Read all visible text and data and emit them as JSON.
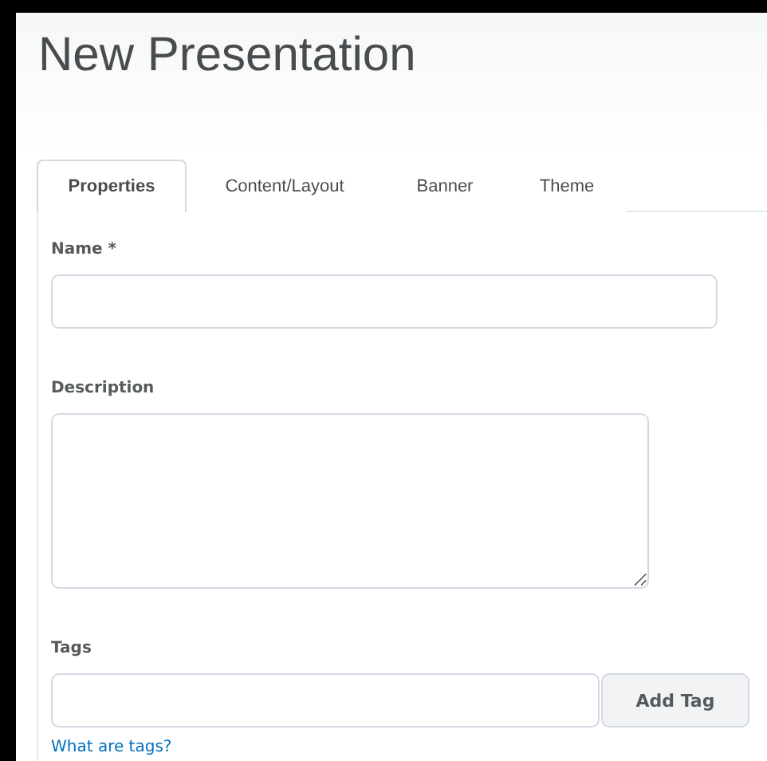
{
  "title": "New Presentation",
  "tabs": [
    {
      "label": "Properties",
      "selected": true
    },
    {
      "label": "Content/Layout",
      "selected": false
    },
    {
      "label": "Banner",
      "selected": false
    },
    {
      "label": "Theme",
      "selected": false
    }
  ],
  "fields": [
    {
      "label": "Name *",
      "kind": "input"
    },
    {
      "label": "Description",
      "kind": "textarea"
    },
    {
      "label": "Tags",
      "kind": "tag",
      "button": "Add Tag",
      "link": "What are tags?"
    }
  ]
}
